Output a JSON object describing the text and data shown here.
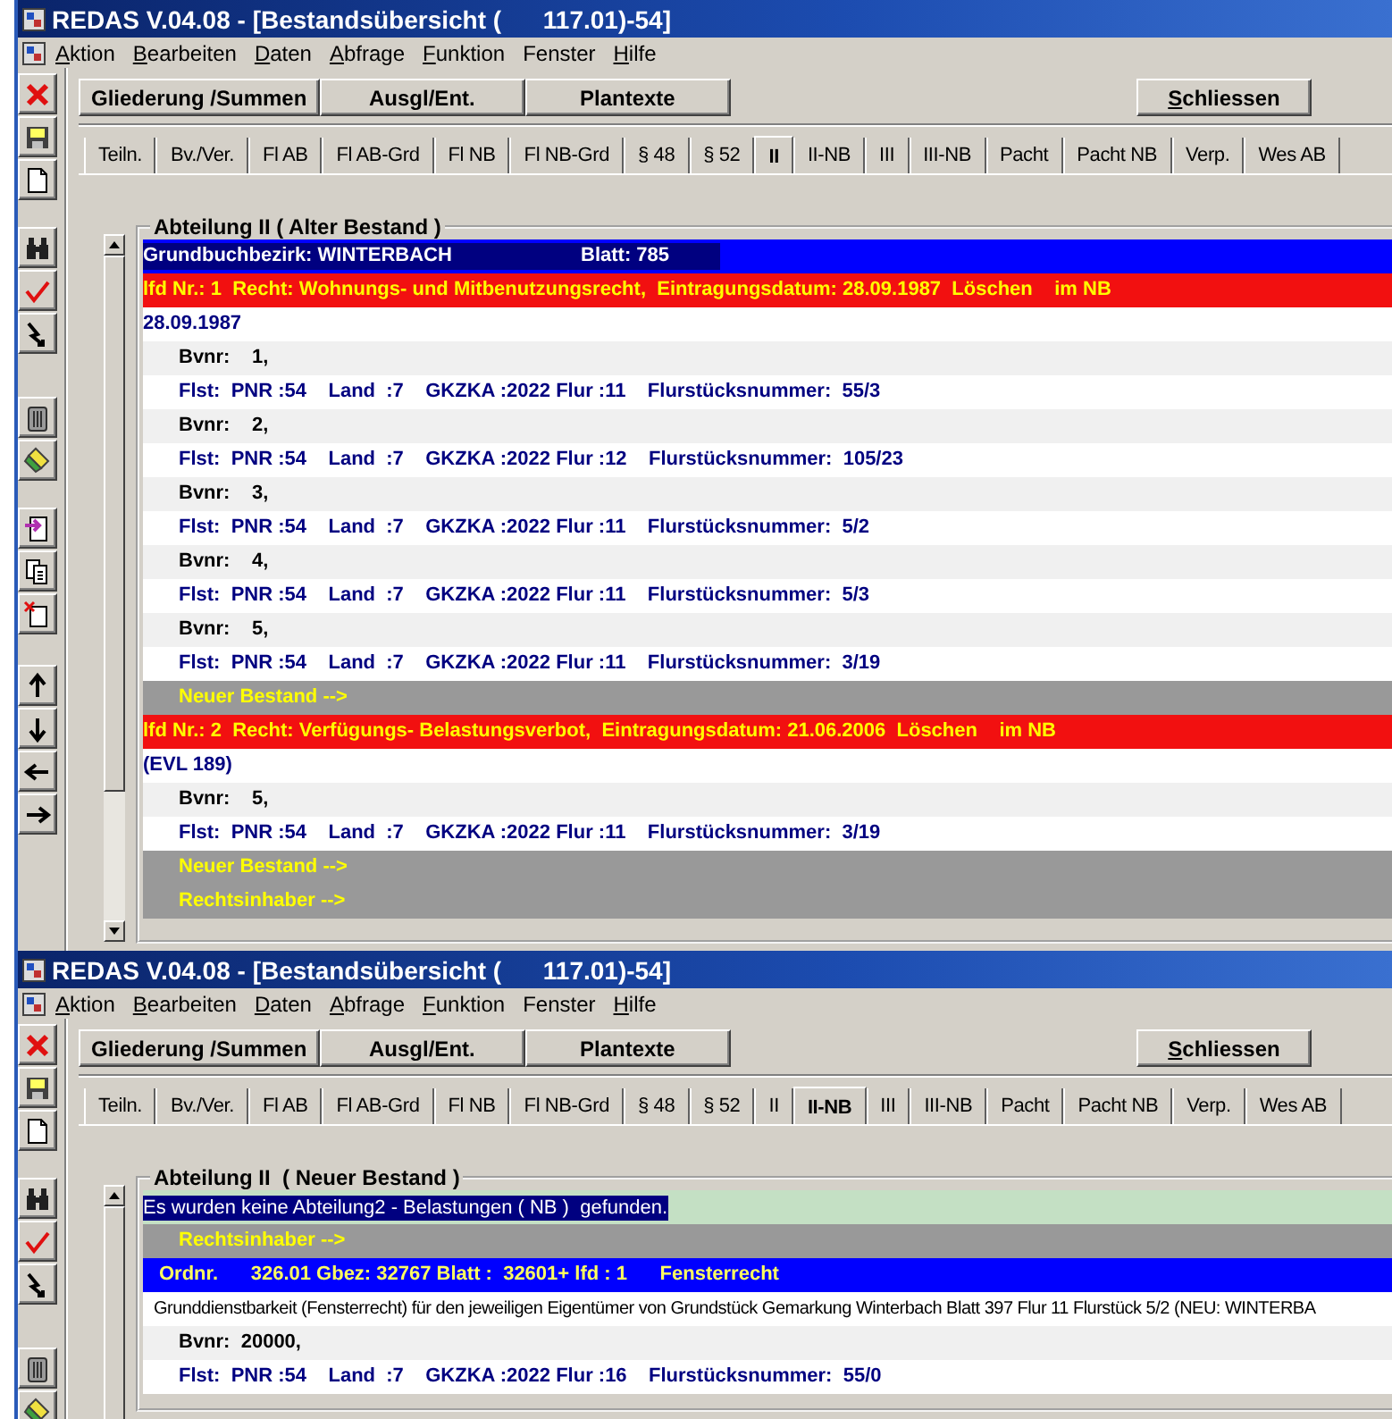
{
  "windows": [
    {
      "title": "REDAS V.04.08 - [Bestandsübersicht (      117.01)-54]",
      "menu": [
        {
          "label": "Aktion",
          "mnemonic": true
        },
        {
          "label": "Bearbeiten",
          "mnemonic": true
        },
        {
          "label": "Daten",
          "mnemonic": true
        },
        {
          "label": "Abfrage",
          "mnemonic": true
        },
        {
          "label": "Funktion",
          "mnemonic": true
        },
        {
          "label": "Fenster",
          "mnemonic": false
        },
        {
          "label": "Hilfe",
          "mnemonic": true
        }
      ],
      "toolbar": [
        {
          "kind": "close"
        },
        {
          "kind": "save"
        },
        {
          "kind": "new"
        },
        {
          "kind": "binoculars"
        },
        {
          "kind": "check"
        },
        {
          "kind": "lightning"
        },
        {
          "kind": "trash"
        },
        {
          "kind": "marker"
        },
        {
          "kind": "import"
        },
        {
          "kind": "copy"
        },
        {
          "kind": "remove"
        },
        {
          "kind": "up"
        },
        {
          "kind": "down"
        },
        {
          "kind": "left"
        },
        {
          "kind": "right"
        }
      ],
      "buttons": [
        {
          "label": "Gliederung /Summen",
          "mnemonic": false
        },
        {
          "label": "Ausgl/Ent.",
          "mnemonic": false
        },
        {
          "label": "Plantexte",
          "mnemonic": false
        }
      ],
      "close_button": {
        "label": "Schliessen",
        "mnemonic": true
      },
      "tabs": [
        {
          "label": "Teiln.",
          "selected": false
        },
        {
          "label": "Bv./Ver.",
          "selected": false
        },
        {
          "label": "Fl AB",
          "selected": false
        },
        {
          "label": "Fl AB-Grd",
          "selected": false
        },
        {
          "label": "Fl NB",
          "selected": false
        },
        {
          "label": "Fl NB-Grd",
          "selected": false
        },
        {
          "label": "§ 48",
          "selected": false
        },
        {
          "label": "§ 52",
          "selected": false
        },
        {
          "label": "II",
          "selected": true
        },
        {
          "label": "II-NB",
          "selected": false
        },
        {
          "label": "III",
          "selected": false
        },
        {
          "label": "III-NB",
          "selected": false
        },
        {
          "label": "Pacht",
          "selected": false
        },
        {
          "label": "Pacht NB",
          "selected": false
        },
        {
          "label": "Verp.",
          "selected": false
        },
        {
          "label": "Wes AB",
          "selected": false
        }
      ],
      "group": {
        "title": "Abteilung II ( Alter Bestand )",
        "rows": [
          {
            "kind": "header",
            "text": "Grundbuchbezirk: WINTERBACH",
            "sheet": "Blatt: 785"
          },
          {
            "kind": "entry",
            "text": "lfd Nr.: 1  Recht: Wohnungs- und Mitbenutzungsrecht,  Eintragungsdatum: 28.09.1987  Löschen    im NB"
          },
          {
            "kind": "note",
            "text": "28.09.1987"
          },
          {
            "kind": "bvnr",
            "text": "Bvnr:    1,"
          },
          {
            "kind": "flst",
            "text": "Flst:  PNR :54    Land  :7    GKZKA :2022 Flur :11    Flurstücksnummer:  55/3"
          },
          {
            "kind": "bvnr",
            "text": "Bvnr:    2,"
          },
          {
            "kind": "flst",
            "text": "Flst:  PNR :54    Land  :7    GKZKA :2022 Flur :12    Flurstücksnummer:  105/23"
          },
          {
            "kind": "bvnr",
            "text": "Bvnr:    3,"
          },
          {
            "kind": "flst",
            "text": "Flst:  PNR :54    Land  :7    GKZKA :2022 Flur :11    Flurstücksnummer:  5/2"
          },
          {
            "kind": "bvnr",
            "text": "Bvnr:    4,"
          },
          {
            "kind": "flst",
            "text": "Flst:  PNR :54    Land  :7    GKZKA :2022 Flur :11    Flurstücksnummer:  5/3"
          },
          {
            "kind": "bvnr",
            "text": "Bvnr:    5,"
          },
          {
            "kind": "flst",
            "text": "Flst:  PNR :54    Land  :7    GKZKA :2022 Flur :11    Flurstücksnummer:  3/19"
          },
          {
            "kind": "link",
            "text": "Neuer Bestand -->"
          },
          {
            "kind": "entry",
            "text": "lfd Nr.: 2  Recht: Verfügungs- Belastungsverbot,  Eintragungsdatum: 21.06.2006  Löschen    im NB"
          },
          {
            "kind": "note",
            "text": "(EVL 189)"
          },
          {
            "kind": "bvnr",
            "text": "Bvnr:    5,"
          },
          {
            "kind": "flst",
            "text": "Flst:  PNR :54    Land  :7    GKZKA :2022 Flur :11    Flurstücksnummer:  3/19"
          },
          {
            "kind": "link",
            "text": "Neuer Bestand -->"
          },
          {
            "kind": "link",
            "text": "Rechtsinhaber -->"
          }
        ]
      }
    },
    {
      "title": "REDAS V.04.08 - [Bestandsübersicht (      117.01)-54]",
      "menu": [
        {
          "label": "Aktion",
          "mnemonic": true
        },
        {
          "label": "Bearbeiten",
          "mnemonic": true
        },
        {
          "label": "Daten",
          "mnemonic": true
        },
        {
          "label": "Abfrage",
          "mnemonic": true
        },
        {
          "label": "Funktion",
          "mnemonic": true
        },
        {
          "label": "Fenster",
          "mnemonic": false
        },
        {
          "label": "Hilfe",
          "mnemonic": true
        }
      ],
      "toolbar": [
        {
          "kind": "close"
        },
        {
          "kind": "save"
        },
        {
          "kind": "new"
        },
        {
          "kind": "binoculars"
        },
        {
          "kind": "check"
        },
        {
          "kind": "lightning"
        },
        {
          "kind": "trash"
        },
        {
          "kind": "marker"
        }
      ],
      "buttons": [
        {
          "label": "Gliederung /Summen",
          "mnemonic": false
        },
        {
          "label": "Ausgl/Ent.",
          "mnemonic": false
        },
        {
          "label": "Plantexte",
          "mnemonic": false
        }
      ],
      "close_button": {
        "label": "Schliessen",
        "mnemonic": true
      },
      "tabs": [
        {
          "label": "Teiln.",
          "selected": false
        },
        {
          "label": "Bv./Ver.",
          "selected": false
        },
        {
          "label": "Fl AB",
          "selected": false
        },
        {
          "label": "Fl AB-Grd",
          "selected": false
        },
        {
          "label": "Fl NB",
          "selected": false
        },
        {
          "label": "Fl NB-Grd",
          "selected": false
        },
        {
          "label": "§ 48",
          "selected": false
        },
        {
          "label": "§ 52",
          "selected": false
        },
        {
          "label": "II",
          "selected": false
        },
        {
          "label": "II-NB",
          "selected": true
        },
        {
          "label": "III",
          "selected": false
        },
        {
          "label": "III-NB",
          "selected": false
        },
        {
          "label": "Pacht",
          "selected": false
        },
        {
          "label": "Pacht NB",
          "selected": false
        },
        {
          "label": "Verp.",
          "selected": false
        },
        {
          "label": "Wes AB",
          "selected": false
        }
      ],
      "group": {
        "title": "Abteilung II  ( Neuer Bestand )",
        "rows": [
          {
            "kind": "info",
            "text": "Es wurden keine Abteilung2 - Belastungen ( NB )  gefunden."
          },
          {
            "kind": "link",
            "text": "Rechtsinhaber -->"
          },
          {
            "kind": "ordnr",
            "text": "Ordnr.      326.01 Gbez: 32767 Blatt :  32601+ lfd : 1      Fensterrecht"
          },
          {
            "kind": "desc",
            "text": "Grunddienstbarkeit (Fensterrecht) für den jeweiligen Eigentümer von Grundstück Gemarkung Winterbach Blatt 397 Flur 11 Flurstück 5/2 (NEU: WINTERBA"
          },
          {
            "kind": "bvnr",
            "text": "Bvnr:  20000,"
          },
          {
            "kind": "flst",
            "text": "Flst:  PNR :54    Land  :7    GKZKA :2022 Flur :16    Flurstücksnummer:  55/0"
          }
        ]
      }
    }
  ]
}
